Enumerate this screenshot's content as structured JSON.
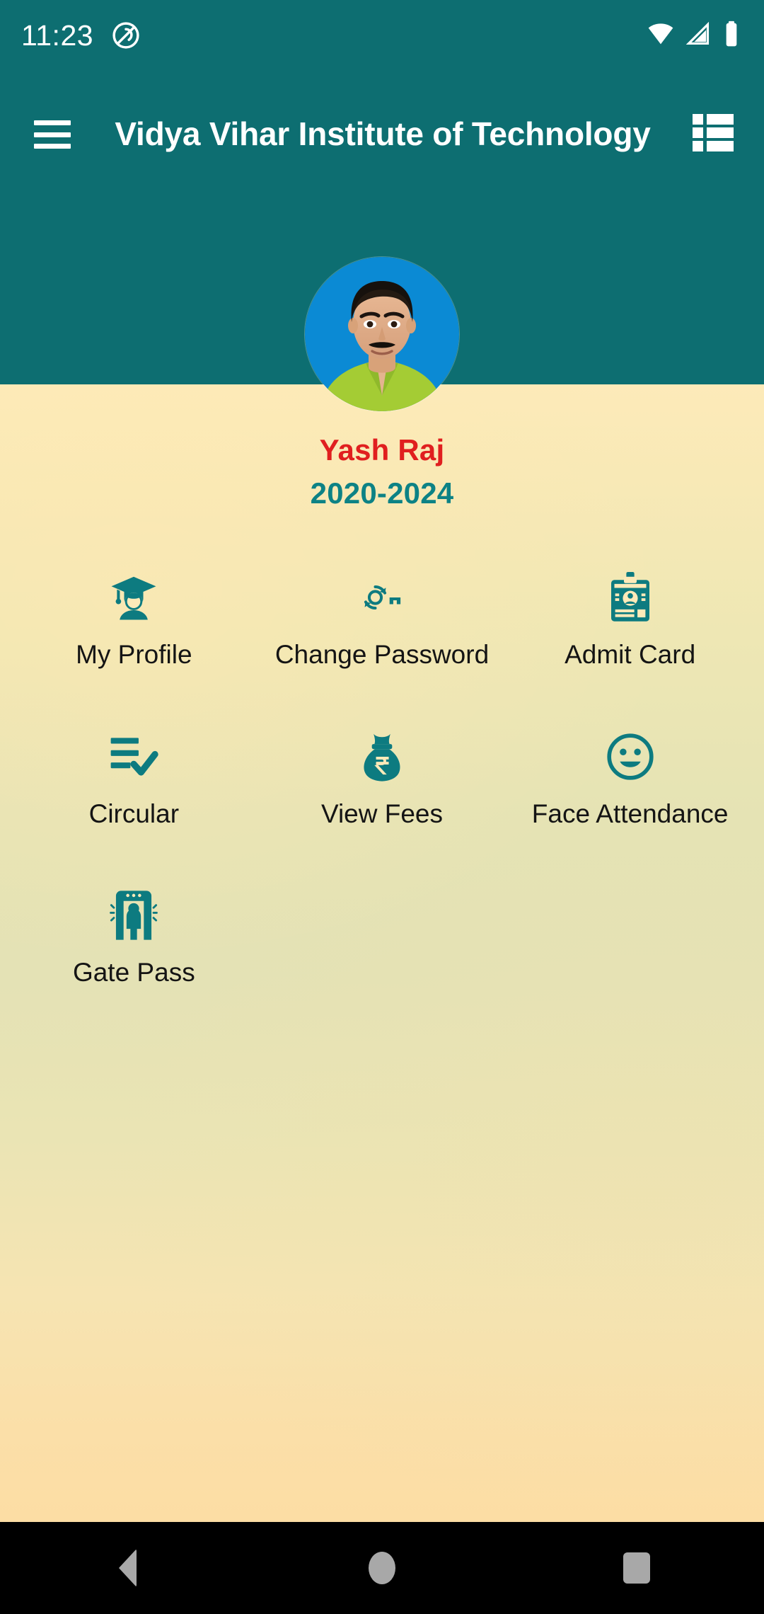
{
  "status_bar": {
    "time": "11:23",
    "icons": [
      "dnd-icon",
      "wifi-icon",
      "cellular-signal-icon",
      "battery-icon"
    ]
  },
  "app_bar": {
    "menu_icon": "hamburger-menu-icon",
    "title": "Vidya Vihar Institute of Technology",
    "action_icon": "list-view-icon",
    "background_color": "#0d6e71"
  },
  "profile": {
    "avatar": "user-avatar-photo",
    "name": "Yash Raj",
    "name_color": "#e01f1f",
    "session": "2020-2024",
    "session_color": "#0d8285"
  },
  "menu": {
    "items": [
      {
        "label": "My Profile",
        "icon": "graduate-student-icon"
      },
      {
        "label": "Change Password",
        "icon": "key-refresh-icon"
      },
      {
        "label": "Admit Card",
        "icon": "id-card-icon"
      },
      {
        "label": "Circular",
        "icon": "list-check-icon"
      },
      {
        "label": "View Fees",
        "icon": "rupee-money-bag-icon"
      },
      {
        "label": "Face Attendance",
        "icon": "smiley-face-icon"
      },
      {
        "label": "Gate Pass",
        "icon": "security-gate-icon"
      }
    ],
    "icon_color": "#0d7b80"
  },
  "nav_bar": {
    "back": "back-triangle-icon",
    "home": "home-circle-icon",
    "recents": "recents-square-icon"
  },
  "theme": {
    "accent": "#0d6e71",
    "background_top": "#fdeab9",
    "background_mid": "#e4e2b5",
    "background_bottom": "#fcdda4"
  }
}
